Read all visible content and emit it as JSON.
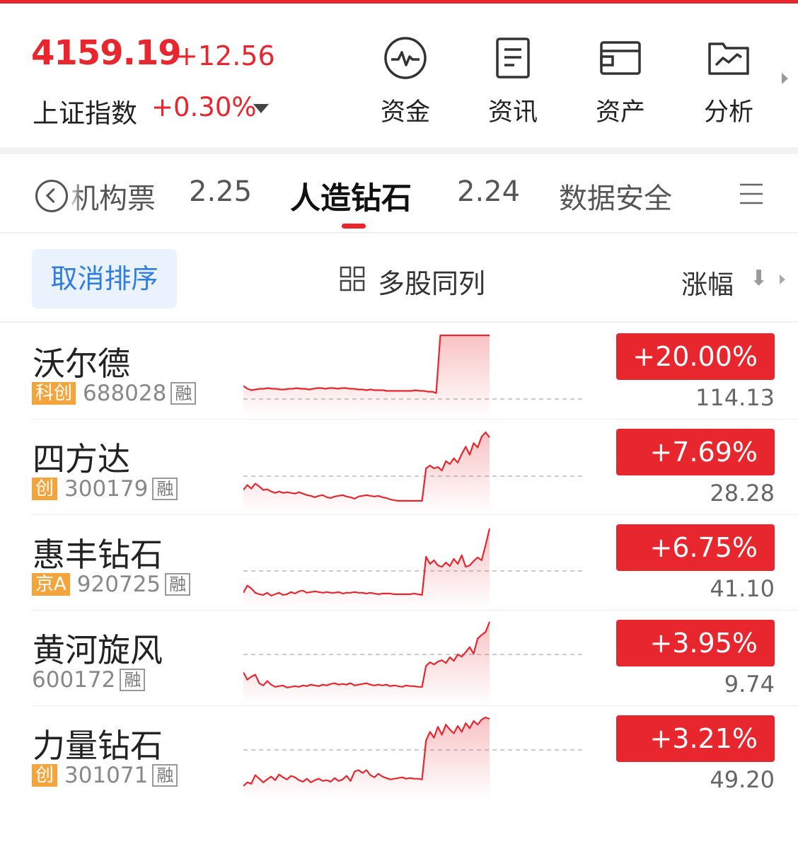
{
  "index": {
    "value": "4159.19",
    "change": "+12.56",
    "name": "上证指数",
    "pct": "+0.30%"
  },
  "quick_buttons": [
    {
      "label": "资金",
      "icon": "pulse-circle-icon"
    },
    {
      "label": "资讯",
      "icon": "document-icon"
    },
    {
      "label": "资产",
      "icon": "wallet-icon"
    },
    {
      "label": "分析",
      "icon": "chart-folder-icon"
    }
  ],
  "tabs": [
    {
      "label": "机构票"
    },
    {
      "label": "2.25"
    },
    {
      "label": "人造钻石",
      "active": true
    },
    {
      "label": "2.24"
    },
    {
      "label": "数据安全"
    }
  ],
  "toolbar": {
    "cancel_sort": "取消排序",
    "multi_stock": "多股同列",
    "sort_by": "涨幅",
    "sort_arrow": "⬇"
  },
  "colors": {
    "accent_red": "#e8262d",
    "link_blue": "#2f7de1",
    "tag_orange": "#f4a43a"
  },
  "stocks": [
    {
      "name": "沃尔德",
      "board": "科创",
      "code": "688028",
      "margin": "融",
      "pct": "+20.00%",
      "price": "114.13",
      "spark": [
        0.3,
        0.26,
        0.24,
        0.25,
        0.26,
        0.26,
        0.27,
        0.26,
        0.26,
        0.25,
        0.25,
        0.26,
        0.26,
        0.27,
        0.26,
        0.26,
        0.25,
        0.26,
        0.27,
        0.27,
        0.26,
        0.27,
        0.27,
        0.26,
        0.27,
        0.27,
        0.26,
        0.26,
        0.25,
        0.25,
        0.24,
        0.25,
        0.24,
        0.24,
        0.24,
        0.23,
        0.23,
        0.23,
        0.23,
        0.23,
        0.23,
        0.23,
        0.24,
        0.23,
        0.23,
        0.22,
        0.22,
        0.2,
        1.0,
        1.0,
        1.0,
        1.0,
        1.0,
        1.0,
        1.0,
        1.0,
        1.0,
        1.0,
        1.0,
        1.0,
        1.0
      ]
    },
    {
      "name": "四方达",
      "board": "创",
      "code": "300179",
      "margin": "融",
      "pct": "+7.69%",
      "price": "28.28",
      "spark": [
        0.18,
        0.25,
        0.2,
        0.27,
        0.23,
        0.18,
        0.19,
        0.16,
        0.14,
        0.16,
        0.14,
        0.15,
        0.14,
        0.13,
        0.15,
        0.13,
        0.11,
        0.1,
        0.08,
        0.1,
        0.11,
        0.08,
        0.07,
        0.09,
        0.1,
        0.11,
        0.09,
        0.08,
        0.06,
        0.09,
        0.1,
        0.11,
        0.1,
        0.09,
        0.1,
        0.08,
        0.07,
        0.05,
        0.04,
        0.03,
        0.03,
        0.03,
        0.03,
        0.03,
        0.03,
        0.03,
        0.48,
        0.52,
        0.48,
        0.5,
        0.45,
        0.58,
        0.54,
        0.62,
        0.56,
        0.68,
        0.78,
        0.67,
        0.83,
        0.77,
        0.92,
        0.98,
        0.91
      ]
    },
    {
      "name": "惠丰钻石",
      "board": "京A",
      "code": "920725",
      "margin": "融",
      "pct": "+6.75%",
      "price": "41.10",
      "spark": [
        0.08,
        0.18,
        0.14,
        0.08,
        0.06,
        0.05,
        0.08,
        0.04,
        0.06,
        0.08,
        0.05,
        0.06,
        0.09,
        0.07,
        0.1,
        0.11,
        0.08,
        0.09,
        0.1,
        0.09,
        0.08,
        0.09,
        0.08,
        0.08,
        0.09,
        0.07,
        0.08,
        0.08,
        0.09,
        0.08,
        0.08,
        0.07,
        0.08,
        0.07,
        0.06,
        0.07,
        0.07,
        0.07,
        0.06,
        0.06,
        0.06,
        0.06,
        0.06,
        0.07,
        0.06,
        0.05,
        0.58,
        0.48,
        0.53,
        0.46,
        0.44,
        0.5,
        0.45,
        0.55,
        0.48,
        0.6,
        0.44,
        0.46,
        0.52,
        0.57,
        0.53,
        0.74,
        0.97
      ]
    },
    {
      "name": "黄河旋风",
      "board": "",
      "code": "600172",
      "margin": "融",
      "pct": "+3.95%",
      "price": "9.74",
      "spark": [
        0.3,
        0.2,
        0.24,
        0.27,
        0.15,
        0.12,
        0.18,
        0.13,
        0.1,
        0.11,
        0.12,
        0.09,
        0.1,
        0.11,
        0.1,
        0.12,
        0.11,
        0.13,
        0.12,
        0.11,
        0.13,
        0.12,
        0.14,
        0.15,
        0.13,
        0.14,
        0.13,
        0.15,
        0.12,
        0.13,
        0.14,
        0.15,
        0.13,
        0.12,
        0.13,
        0.12,
        0.13,
        0.11,
        0.12,
        0.11,
        0.1,
        0.12,
        0.11,
        0.11,
        0.1,
        0.1,
        0.39,
        0.44,
        0.41,
        0.45,
        0.47,
        0.43,
        0.51,
        0.46,
        0.55,
        0.52,
        0.58,
        0.65,
        0.56,
        0.77,
        0.82,
        0.86,
        1.0
      ]
    },
    {
      "name": "力量钻石",
      "board": "创",
      "code": "301071",
      "margin": "融",
      "pct": "+3.21%",
      "price": "49.20",
      "spark": [
        0.05,
        0.1,
        0.08,
        0.2,
        0.15,
        0.1,
        0.14,
        0.18,
        0.13,
        0.21,
        0.17,
        0.14,
        0.19,
        0.17,
        0.13,
        0.11,
        0.15,
        0.1,
        0.13,
        0.15,
        0.12,
        0.13,
        0.11,
        0.16,
        0.12,
        0.14,
        0.19,
        0.12,
        0.25,
        0.27,
        0.23,
        0.27,
        0.2,
        0.17,
        0.22,
        0.18,
        0.16,
        0.14,
        0.15,
        0.16,
        0.17,
        0.15,
        0.16,
        0.15,
        0.15,
        0.14,
        0.68,
        0.8,
        0.72,
        0.87,
        0.76,
        0.9,
        0.83,
        0.78,
        0.88,
        0.8,
        0.92,
        0.85,
        0.95,
        0.9,
        0.97,
        1.0,
        0.98
      ]
    }
  ]
}
